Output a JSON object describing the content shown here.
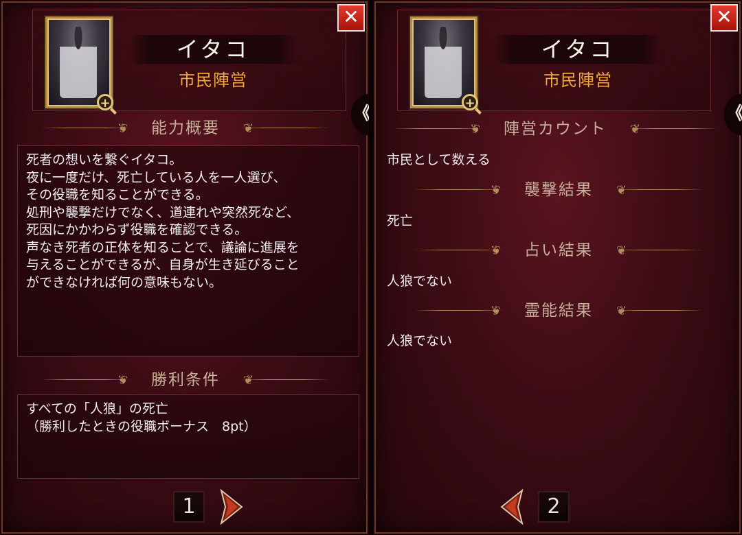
{
  "close_glyph": "✕",
  "side_tab_glyph": "《",
  "panel1": {
    "name": "イタコ",
    "faction": "市民陣営",
    "zoom_glyph": "+",
    "ability_title": "能力概要",
    "ability_lines": [
      "死者の想いを繋ぐイタコ。",
      "夜に一度だけ、死亡している人を一人選び、",
      "その役職を知ることができる。",
      "処刑や襲撃だけでなく、道連れや突然死など、",
      "死因にかかわらず役職を確認できる。",
      "声なき死者の正体を知ることで、議論に進展を",
      "与えることができるが、自身が生き延びること",
      "ができなければ何の意味もない。"
    ],
    "victory_title": "勝利条件",
    "victory_lines": [
      "すべての「人狼」の死亡",
      "（勝利したときの役職ボーナス　8pt）"
    ],
    "page_number": "1"
  },
  "panel2": {
    "name": "イタコ",
    "faction": "市民陣営",
    "zoom_glyph": "+",
    "faction_count_title": "陣営カウント",
    "faction_count_value": "市民として数える",
    "attack_title": "襲撃結果",
    "attack_value": "死亡",
    "divination_title": "占い結果",
    "divination_value": "人狼でない",
    "medium_title": "霊能結果",
    "medium_value": "人狼でない",
    "page_number": "2"
  },
  "colors": {
    "panel_bg": "#3d0c15",
    "title_gold": "#c8b09a",
    "faction_orange": "#f0a93a",
    "close_red": "#d12a1e",
    "frame_gold": "#b48a45"
  },
  "icons": {
    "close": "close-icon",
    "zoom": "zoom-in-icon",
    "next": "next-page-arrow-icon",
    "prev": "prev-page-arrow-icon",
    "side": "collapse-tab-icon"
  }
}
